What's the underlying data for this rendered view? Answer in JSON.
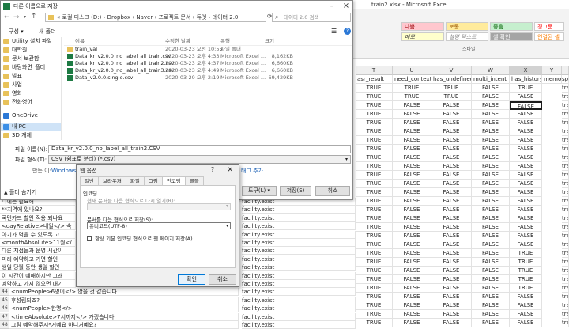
{
  "excel": {
    "title": "train2.xlsx - Microsoft Excel",
    "styles": [
      {
        "label": "나쁨",
        "bg": "#ffc7ce",
        "color": "#9c0006"
      },
      {
        "label": "보통",
        "bg": "#ffeb9c",
        "color": "#9c5700"
      },
      {
        "label": "좋음",
        "bg": "#c6efce",
        "color": "#006100"
      },
      {
        "label": "경고문",
        "bg": "#ffffff",
        "color": "#ff0000"
      },
      {
        "label": "메모",
        "bg": "#ffffcc",
        "color": "#333333"
      },
      {
        "label": "설명 텍스트",
        "bg": "#ffffff",
        "color": "#7f7f7f"
      },
      {
        "label": "셀 확인",
        "bg": "#a5a5a5",
        "color": "#ffffff"
      },
      {
        "label": "연결된 셀",
        "bg": "#ffffff",
        "color": "#fa7d00"
      }
    ],
    "styles_group_label": "스타일",
    "columns": [
      "T",
      "U",
      "V",
      "W",
      "X",
      "Y"
    ],
    "headers": [
      "asr_result",
      "need_context",
      "has_undefined",
      "multi_intent",
      "has_history",
      "memo"
    ],
    "extra_col_header": "sp",
    "extra_col_value": "tra",
    "bool_rows": [
      [
        "TRUE",
        "TRUE",
        "TRUE",
        "FALSE",
        "TRUE"
      ],
      [
        "TRUE",
        "TRUE",
        "TRUE",
        "FALSE",
        "FALSE"
      ],
      [
        "TRUE",
        "FALSE",
        "FALSE",
        "FALSE",
        "FALSE"
      ],
      [
        "TRUE",
        "FALSE",
        "FALSE",
        "FALSE",
        "FALSE"
      ],
      [
        "TRUE",
        "FALSE",
        "FALSE",
        "FALSE",
        "FALSE"
      ],
      [
        "TRUE",
        "FALSE",
        "FALSE",
        "FALSE",
        "FALSE"
      ],
      [
        "TRUE",
        "FALSE",
        "FALSE",
        "FALSE",
        "FALSE"
      ],
      [
        "TRUE",
        "FALSE",
        "FALSE",
        "FALSE",
        "FALSE"
      ],
      [
        "TRUE",
        "FALSE",
        "FALSE",
        "FALSE",
        "FALSE"
      ],
      [
        "TRUE",
        "FALSE",
        "FALSE",
        "FALSE",
        "FALSE"
      ],
      [
        "TRUE",
        "FALSE",
        "FALSE",
        "FALSE",
        "FALSE"
      ],
      [
        "TRUE",
        "FALSE",
        "FALSE",
        "FALSE",
        "FALSE"
      ],
      [
        "TRUE",
        "FALSE",
        "FALSE",
        "FALSE",
        "FALSE"
      ],
      [
        "TRUE",
        "FALSE",
        "FALSE",
        "FALSE",
        "FALSE"
      ],
      [
        "TRUE",
        "FALSE",
        "FALSE",
        "FALSE",
        "FALSE"
      ],
      [
        "TRUE",
        "FALSE",
        "FALSE",
        "FALSE",
        "FALSE"
      ],
      [
        "TRUE",
        "FALSE",
        "FALSE",
        "FALSE",
        "FALSE"
      ],
      [
        "TRUE",
        "FALSE",
        "FALSE",
        "FALSE",
        "FALSE"
      ],
      [
        "TRUE",
        "FALSE",
        "FALSE",
        "FALSE",
        "FALSE"
      ],
      [
        "TRUE",
        "FALSE",
        "FALSE",
        "FALSE",
        "TRUE"
      ],
      [
        "TRUE",
        "FALSE",
        "FALSE",
        "FALSE",
        "TRUE"
      ],
      [
        "TRUE",
        "FALSE",
        "FALSE",
        "FALSE",
        "TRUE"
      ],
      [
        "TRUE",
        "FALSE",
        "FALSE",
        "FALSE",
        "TRUE"
      ],
      [
        "TRUE",
        "FALSE",
        "FALSE",
        "FALSE",
        "TRUE"
      ],
      [
        "TRUE",
        "FALSE",
        "FALSE",
        "FALSE",
        "FALSE"
      ],
      [
        "TRUE",
        "FALSE",
        "FALSE",
        "FALSE",
        "FALSE"
      ],
      [
        "TRUE",
        "FALSE",
        "FALSE",
        "FALSE",
        "FALSE"
      ],
      [
        "TRUE",
        "FALSE",
        "FALSE",
        "FALSE",
        "FALSE"
      ]
    ],
    "row_numbers": [
      "44",
      "45",
      "46",
      "47",
      "48",
      "49"
    ],
    "left_rows": [
      {
        "text": "니에는 필요해",
        "intent": "facility.exist"
      },
      {
        "text": "**지역에 있나요?",
        "intent": "facility.exist"
      },
      {
        "text": "국민카드 할인 적용 되나요",
        "intent": "facility.exist"
      },
      {
        "text": "<dayRelative>내일</> 숙",
        "intent": "facility.exist"
      },
      {
        "text": "아기가 먹을 수 있도록 고",
        "intent": "facility.exist"
      },
      {
        "text": "<monthAbsolute>11월</",
        "intent": "facility.exist"
      },
      {
        "text": "다른 지점들과 운영 시간이",
        "intent": "facility.exist"
      },
      {
        "text": "미리 예약하고 가면 할인",
        "intent": "facility.exist"
      },
      {
        "text": "생일 당월 동안 생일 할인",
        "intent": "facility.exist"
      },
      {
        "text": "이 시간이 예매하지만 그래",
        "intent": "facility.exist"
      },
      {
        "text": "예약하고 가지 않으면 대기",
        "intent": "facility.exist"
      },
      {
        "text": "<numPeople>6명이</> 앉을 것 같습니다.",
        "intent": "facility.exist"
      },
      {
        "text": "후성림되죠?",
        "intent": "facility.exist"
      },
      {
        "text": "<numPeople>한명</>",
        "intent": "facility.exist"
      },
      {
        "text": "<timeAbsolute>7시까지</> 가겠습니다.",
        "intent": "facility.exist"
      },
      {
        "text": "그럼 예약해주시*거예요 아니거예요?",
        "intent": "facility.exist"
      }
    ]
  },
  "save_dialog": {
    "title": "다른 이름으로 저장",
    "address": "« 로컬 디스크 (D:) › Dropbox › Naver › 프로젝트 문서 › 듀엣 › 데이터 2.0",
    "search_placeholder": "데이터 2.0 검색",
    "toolbar_org": "구성 ▾",
    "toolbar_newfolder": "새 폴더",
    "nav_items": [
      {
        "label": "Utility 설치 파일",
        "type": "folder"
      },
      {
        "label": "대학원",
        "type": "folder"
      },
      {
        "label": "문서 보관함",
        "type": "folder"
      },
      {
        "label": "바탕화면_폴더",
        "type": "folder"
      },
      {
        "label": "발표",
        "type": "folder"
      },
      {
        "label": "사업",
        "type": "folder"
      },
      {
        "label": "영화",
        "type": "folder"
      },
      {
        "label": "전화영어",
        "type": "folder"
      },
      {
        "label": "OneDrive",
        "type": "onedrive"
      },
      {
        "label": "내 PC",
        "type": "pc"
      },
      {
        "label": "3D 개체",
        "type": "folder"
      }
    ],
    "file_headers": {
      "name": "이름",
      "date": "수정한 날짜",
      "type": "유형",
      "size": "크기"
    },
    "files": [
      {
        "name": "train_val",
        "date": "2020-03-23 오전 10:55",
        "type": "파일 폴더",
        "size": "",
        "kind": "folder"
      },
      {
        "name": "Data_kr_v2.0.0_no_label_all_train.csv",
        "date": "2020-03-23 오후 4:33",
        "type": "Microsoft Excel ...",
        "size": "8,162KB",
        "kind": "xls"
      },
      {
        "name": "Data_kr_v2.0.0_no_label_all_train2.csv",
        "date": "2020-03-23 오후 4:37",
        "type": "Microsoft Excel ...",
        "size": "6,660KB",
        "kind": "xls"
      },
      {
        "name": "Data_kr_v2.0.0_no_label_all_train3.csv",
        "date": "2020-03-23 오후 4:49",
        "type": "Microsoft Excel ...",
        "size": "6,660KB",
        "kind": "xls"
      },
      {
        "name": "Data_v2.0.0.single.csv",
        "date": "2020-03-20 오후 2:19",
        "type": "Microsoft Excel ...",
        "size": "69,429KB",
        "kind": "xls"
      }
    ],
    "filename_label": "파일 이름(N):",
    "filename_value": "Data_kr_v2.0.0_no_label_all_train2.CSV",
    "filetype_label": "파일 형식(T):",
    "filetype_value": "CSV (쉼표로 분리) (*.csv)",
    "authors_label": "만든 이:",
    "authors_value": "Windows 사",
    "tags_link": "태그 추가",
    "hide_folders": "폴더 숨기기",
    "tools_button": "도구(L)",
    "save_button": "저장(S)",
    "cancel_button": "취소"
  },
  "web_dialog": {
    "title": "웹 옵션",
    "help": "?",
    "tabs": [
      "일반",
      "브라우저",
      "파일",
      "그림",
      "인코딩",
      "글꼴"
    ],
    "active_tab": 4,
    "group_label": "인코딩",
    "reload_label": "현재 문서를 다음 형식으로 다시 열기(R):",
    "save_as_label": "문서를 다음 형식으로 저장(S):",
    "encoding_value": "유니코드(UTF-8)",
    "checkbox_label": "항상 기본 인코딩 형식으로 웹 페이지 저장(A)",
    "ok_button": "확인",
    "cancel_button": "취소"
  }
}
